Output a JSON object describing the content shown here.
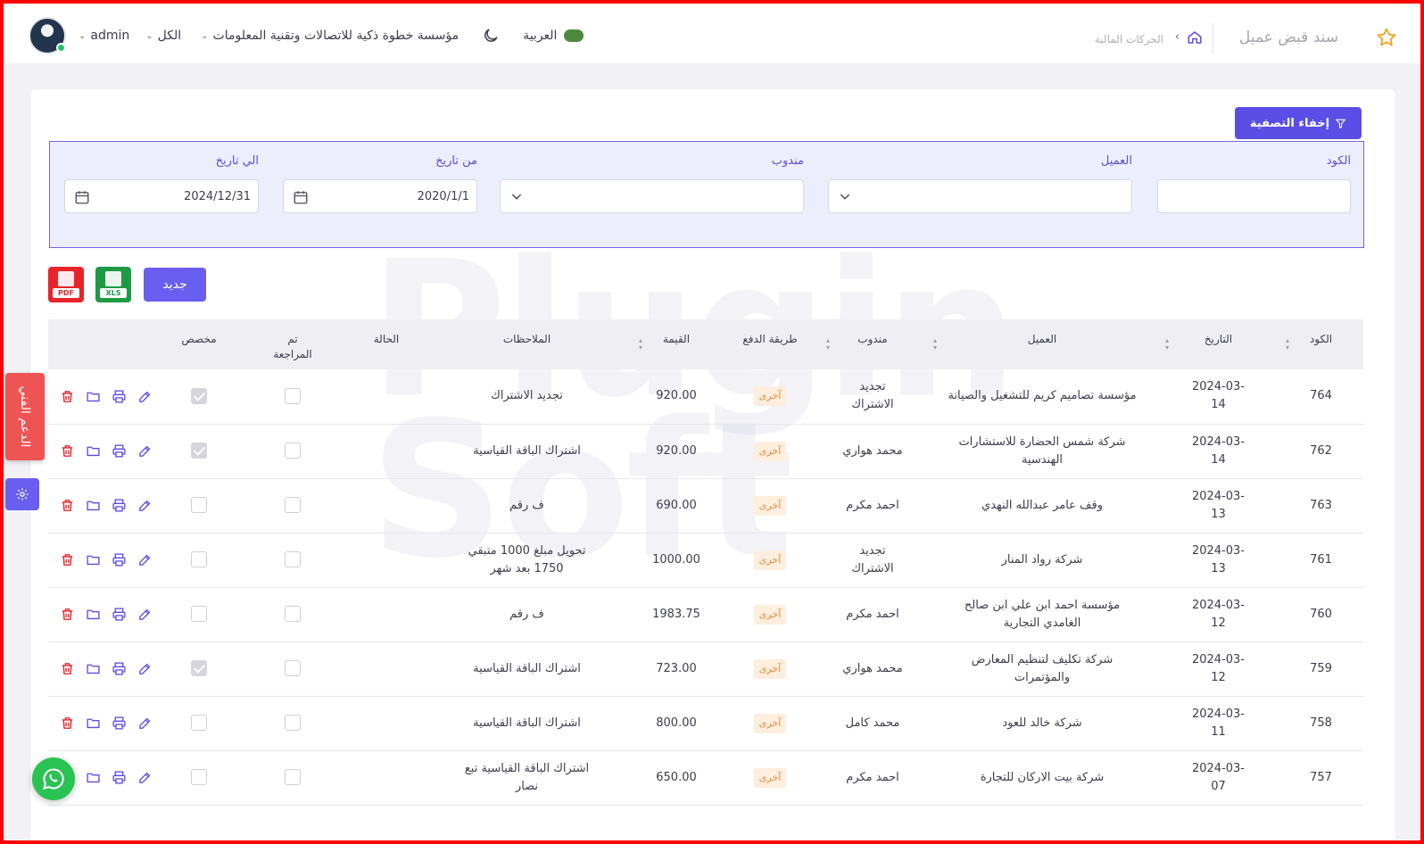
{
  "header": {
    "page_title": "سند قبض عميل",
    "breadcrumb": "الحركات المالية",
    "language": "العربية",
    "company": "مؤسسة خطوة ذكية للاتصالات وتقنية المعلومات",
    "branch": "الكل",
    "user": "admin"
  },
  "toolbar": {
    "hide_filter_label": "إخفاء التصفية",
    "new_label": "جديد",
    "pdf_label": "PDF",
    "xls_label": "XLS"
  },
  "filters": {
    "code_label": "الكود",
    "code_value": "",
    "client_label": "العميل",
    "rep_label": "مندوب",
    "from_label": "من تاريخ",
    "from_value": "2020/1/1",
    "to_label": "الي تاريخ",
    "to_value": "2024/12/31"
  },
  "table": {
    "headers": {
      "code": "الكود",
      "date": "التاريخ",
      "client": "العميل",
      "rep": "مندوب",
      "payment": "طريقة الدفع",
      "amount": "القيمة",
      "notes": "الملاحظات",
      "status": "الحالة",
      "reviewed": "تم المراجعة",
      "allocated": "مخصص"
    },
    "rows": [
      {
        "code": "764",
        "date": "2024-03-14",
        "client": "مؤسسة تصاميم كريم للتشغيل والصيانة",
        "rep": "تجديد الاشتراك",
        "payment": "آخرى",
        "amount": "920.00",
        "notes": "تجديد الاشتراك",
        "status": "",
        "reviewed": false,
        "allocated": true
      },
      {
        "code": "762",
        "date": "2024-03-14",
        "client": "شركة شمس الحضارة للاستشارات الهندسية",
        "rep": "محمد هواري",
        "payment": "آخرى",
        "amount": "920.00",
        "notes": "اشتراك الباقة القياسية",
        "status": "",
        "reviewed": false,
        "allocated": true
      },
      {
        "code": "763",
        "date": "2024-03-13",
        "client": "وقف عامر عبدالله النهدي",
        "rep": "احمد مكرم",
        "payment": "آخرى",
        "amount": "690.00",
        "notes": "ف رقم",
        "status": "",
        "reviewed": false,
        "allocated": false
      },
      {
        "code": "761",
        "date": "2024-03-13",
        "client": "شركة رواد المنار",
        "rep": "تجديد الاشتراك",
        "payment": "آخرى",
        "amount": "1000.00",
        "notes": "تحويل مبلغ 1000 متبقي 1750 بعد شهر",
        "status": "",
        "reviewed": false,
        "allocated": false
      },
      {
        "code": "760",
        "date": "2024-03-12",
        "client": "مؤسسة احمد ابن علي ابن صالح الغامدي التجارية",
        "rep": "احمد مكرم",
        "payment": "آخرى",
        "amount": "1983.75",
        "notes": "ف رقم",
        "status": "",
        "reviewed": false,
        "allocated": false
      },
      {
        "code": "759",
        "date": "2024-03-12",
        "client": "شركة تكليف لتنظيم المعارض والمؤتمرات",
        "rep": "محمد هواري",
        "payment": "آخرى",
        "amount": "723.00",
        "notes": "اشتراك الباقة القياسية",
        "status": "",
        "reviewed": false,
        "allocated": true
      },
      {
        "code": "758",
        "date": "2024-03-11",
        "client": "شركة خالد للعود",
        "rep": "محمد كامل",
        "payment": "آخرى",
        "amount": "800.00",
        "notes": "اشتراك الباقة القياسية",
        "status": "",
        "reviewed": false,
        "allocated": false
      },
      {
        "code": "757",
        "date": "2024-03-07",
        "client": "شركة بيت الاركان للتجارة",
        "rep": "احمد مكرم",
        "payment": "آخرى",
        "amount": "650.00",
        "notes": "اشتراك الباقة القياسية تبع نصار",
        "status": "",
        "reviewed": false,
        "allocated": false
      }
    ]
  },
  "floating": {
    "support_label": "الدعم الفني"
  },
  "colors": {
    "primary": "#5b4ee6",
    "delete": "#e8242a",
    "badge_text": "#e98a3c",
    "support": "#ee5454",
    "whatsapp": "#29c253"
  },
  "icons": [
    "star-icon",
    "home-icon",
    "chevron-left-icon",
    "moon-icon",
    "chevron-down-icon",
    "filter-icon",
    "calendar-icon",
    "edit-icon",
    "print-icon",
    "folder-icon",
    "delete-icon",
    "settings-icon",
    "whatsapp-icon",
    "pdf-icon",
    "xls-icon"
  ]
}
